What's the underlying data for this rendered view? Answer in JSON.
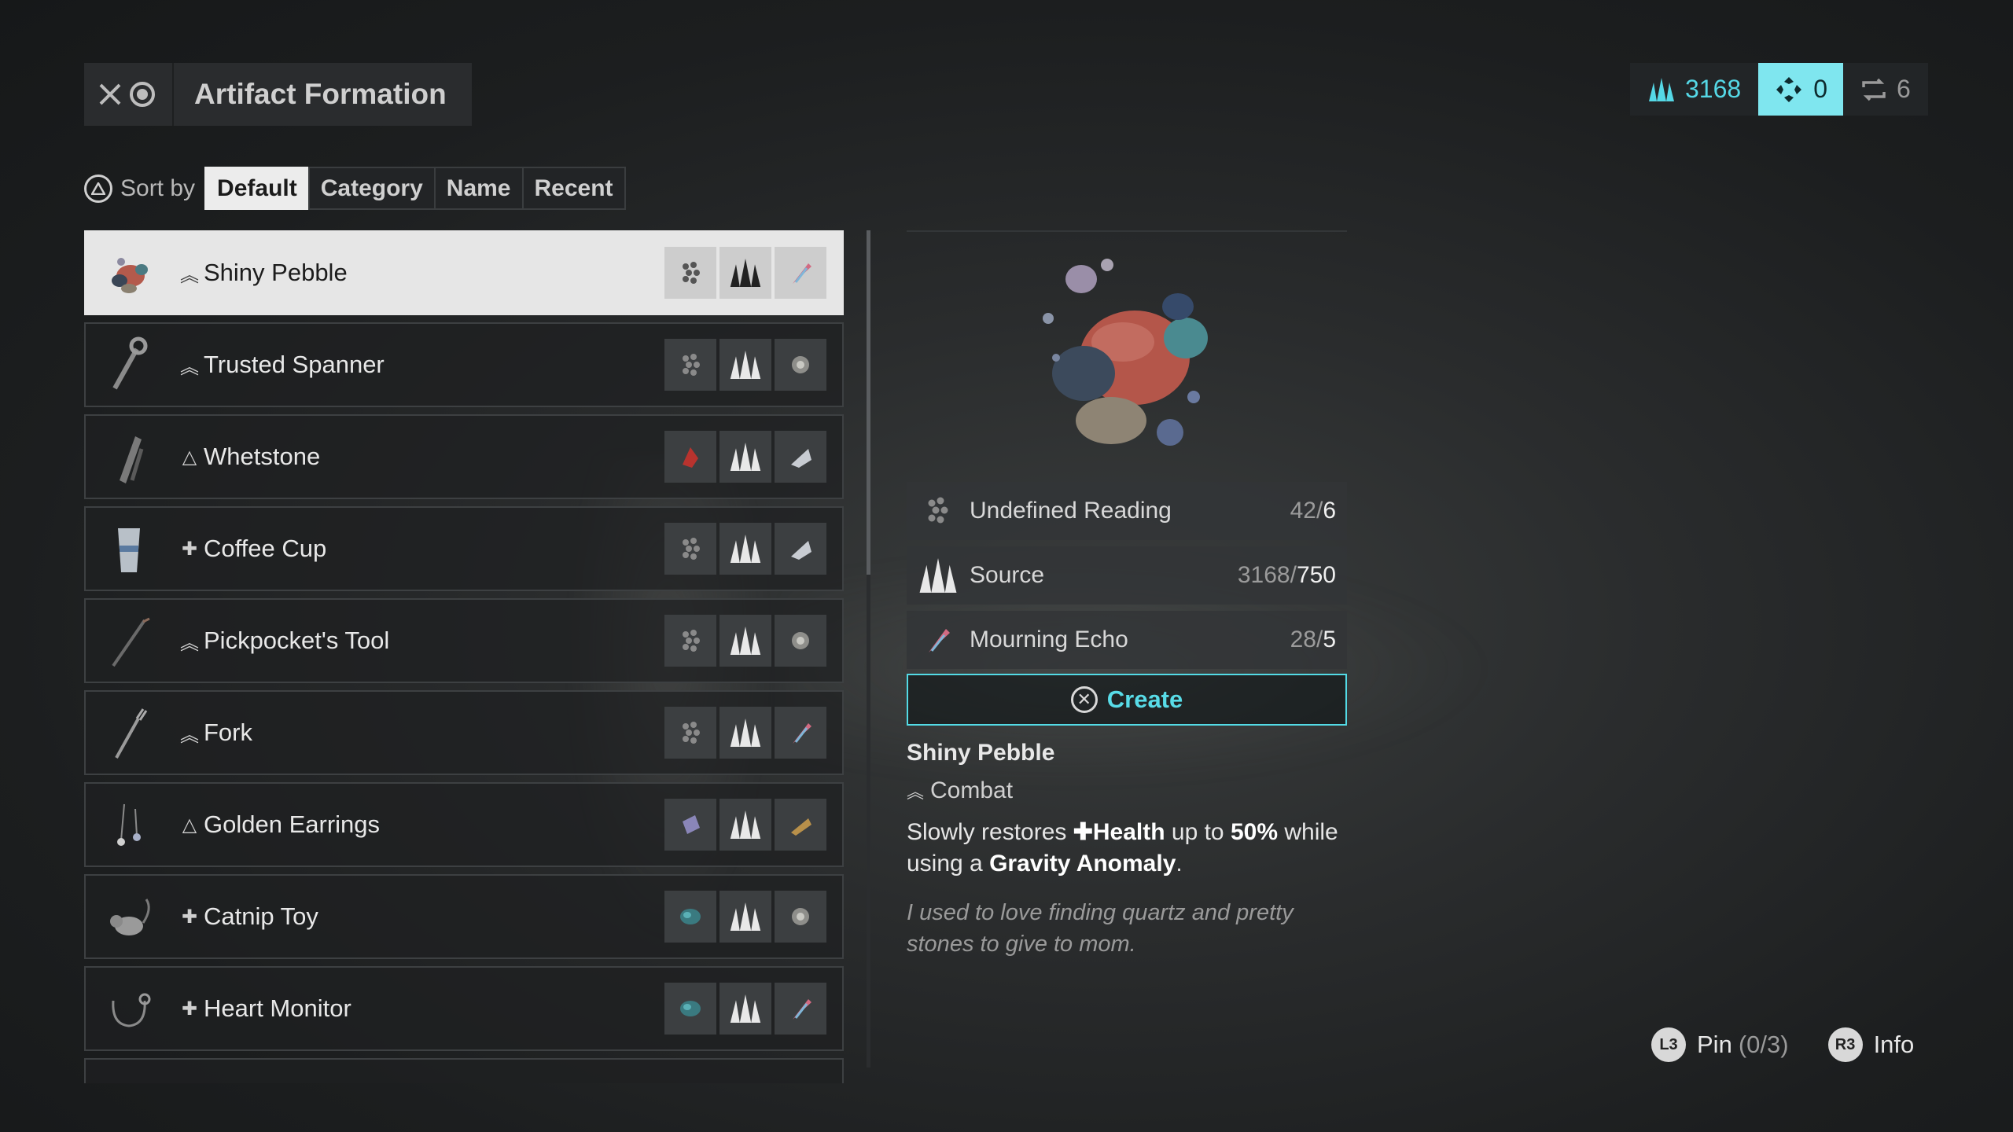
{
  "header": {
    "title": "Artifact Formation",
    "close_icon": "close-icon",
    "circle_button_icon": "circle-button-icon"
  },
  "currency": {
    "source_value": "3168",
    "active_value": "0",
    "swap_value": "6",
    "accent": "#55d8e6"
  },
  "sort": {
    "label": "Sort by",
    "options": [
      "Default",
      "Category",
      "Name",
      "Recent"
    ],
    "active": "Default"
  },
  "list": {
    "items": [
      {
        "name": "Shiny Pebble",
        "tier": "^^",
        "selected": true
      },
      {
        "name": "Trusted Spanner",
        "tier": "^^"
      },
      {
        "name": "Whetstone",
        "tier": "tri"
      },
      {
        "name": "Coffee Cup",
        "tier": "+"
      },
      {
        "name": "Pickpocket's Tool",
        "tier": "^^"
      },
      {
        "name": "Fork",
        "tier": "^^"
      },
      {
        "name": "Golden Earrings",
        "tier": "tri"
      },
      {
        "name": "Catnip Toy",
        "tier": "+"
      },
      {
        "name": "Heart Monitor",
        "tier": "+"
      }
    ]
  },
  "detail": {
    "requirements": [
      {
        "name": "Undefined Reading",
        "have": "42",
        "need": "6"
      },
      {
        "name": "Source",
        "have": "3168",
        "need": "750"
      },
      {
        "name": "Mourning Echo",
        "have": "28",
        "need": "5"
      }
    ],
    "create_label": "Create",
    "item_name": "Shiny Pebble",
    "category": "Combat",
    "desc_pre": "Slowly restores ",
    "desc_health": "Health",
    "desc_mid": " up to ",
    "desc_pct": "50%",
    "desc_mid2": " while using a ",
    "desc_anomaly": "Gravity Anomaly",
    "desc_end": ".",
    "flavor": "I used to love finding quartz and pretty stones to give to mom."
  },
  "prompts": {
    "pin_button": "L3",
    "pin_label": "Pin",
    "pin_count": "(0/3)",
    "info_button": "R3",
    "info_label": "Info"
  }
}
